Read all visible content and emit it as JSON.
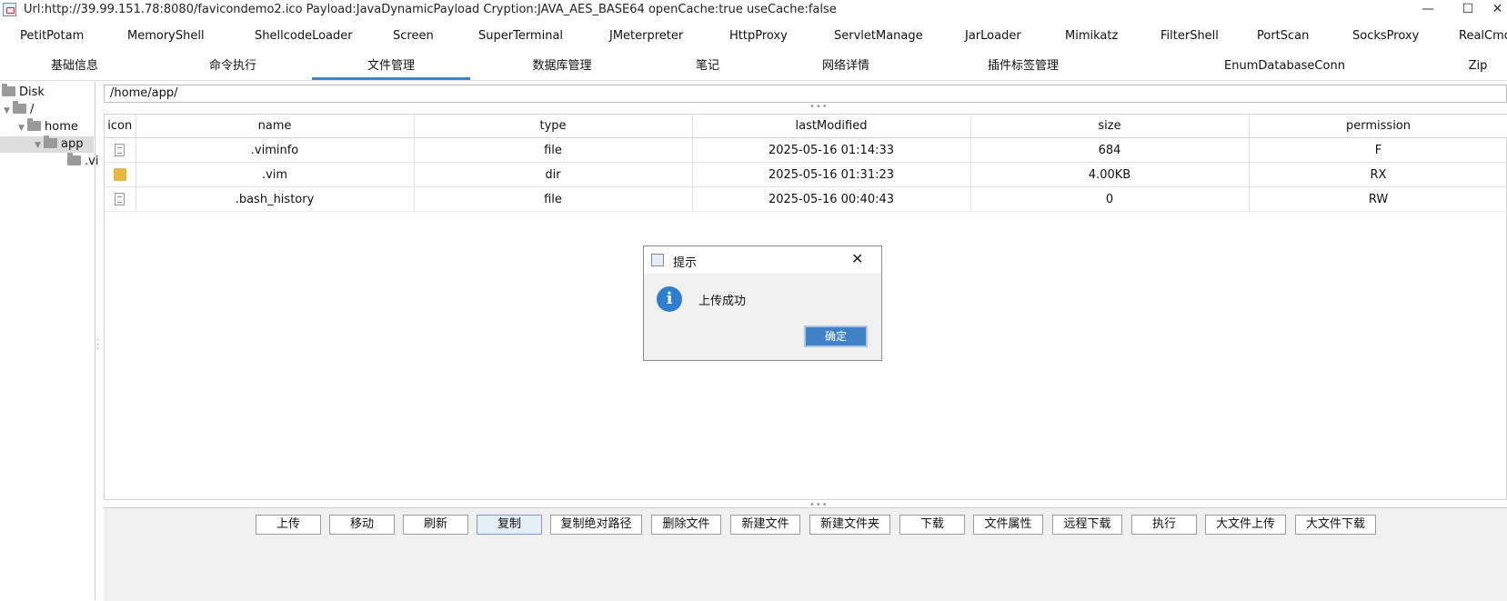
{
  "window": {
    "title": "Url:http://39.99.151.78:8080/favicondemo2.ico Payload:JavaDynamicPayload Cryption:JAVA_AES_BASE64 openCache:true useCache:false",
    "min_glyph": "—",
    "max_glyph": "☐",
    "close_glyph": "✕"
  },
  "plugins": [
    "PetitPotam",
    "MemoryShell",
    "ShellcodeLoader",
    "Screen",
    "SuperTerminal",
    "JMeterpreter",
    "HttpProxy",
    "ServletManage",
    "JarLoader",
    "Mimikatz",
    "FilterShell",
    "PortScan",
    "SocksProxy",
    "RealCmd"
  ],
  "tabs": [
    "基础信息",
    "命令执行",
    "文件管理",
    "数据库管理",
    "笔记",
    "网络详情",
    "插件标签管理",
    "EnumDatabaseConn",
    "Zip"
  ],
  "active_tab": "文件管理",
  "tree": {
    "root": "Disk",
    "slash": "/",
    "home": "home",
    "app": "app",
    "vim": ".vi"
  },
  "path": "/home/app/",
  "table": {
    "headers": [
      "icon",
      "name",
      "type",
      "lastModified",
      "size",
      "permission"
    ],
    "rows": [
      {
        "icon": "file-icon",
        "name": ".viminfo",
        "type": "file",
        "lastModified": "2025-05-16 01:14:33",
        "size": "684",
        "permission": "F"
      },
      {
        "icon": "folder-icon",
        "name": ".vim",
        "type": "dir",
        "lastModified": "2025-05-16 01:31:23",
        "size": "4.00KB",
        "permission": "RX"
      },
      {
        "icon": "file-icon",
        "name": ".bash_history",
        "type": "file",
        "lastModified": "2025-05-16 00:40:43",
        "size": "0",
        "permission": "RW"
      }
    ]
  },
  "buttons": [
    "上传",
    "移动",
    "刷新",
    "复制",
    "复制绝对路径",
    "删除文件",
    "新建文件",
    "新建文件夹",
    "下载",
    "文件属性",
    "远程下载",
    "执行",
    "大文件上传",
    "大文件下载"
  ],
  "dialog": {
    "title": "提示",
    "message": "上传成功",
    "ok": "确定",
    "info_glyph": "i",
    "close_glyph": "✕"
  },
  "colors": {
    "accent": "#3d83c6",
    "info": "#2f7fce",
    "folder": "#e9b740"
  }
}
